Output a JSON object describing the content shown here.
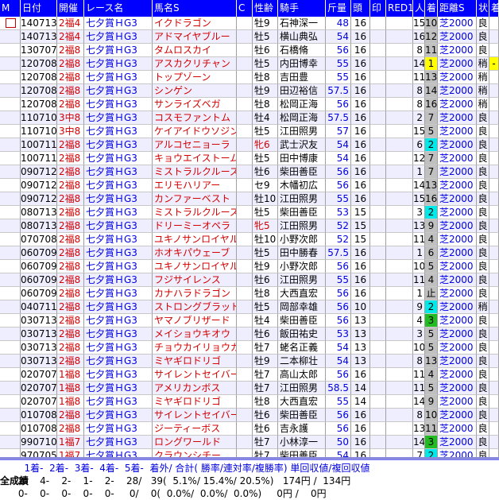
{
  "headers": [
    "M",
    "日付",
    "開催",
    "レース名",
    "馬名S",
    "C",
    "性齢",
    "騎手",
    "斤量",
    "頭",
    "印",
    "RED1",
    "人",
    "着",
    "距離S",
    "状",
    "着"
  ],
  "rows": [
    [
      "",
      "140713",
      "2福4",
      "七夕賞ＨG3",
      "イクドラゴン",
      "",
      "牡9",
      "石神深一",
      "48",
      "16",
      "",
      "",
      "15",
      "10",
      "芝2000",
      "良",
      ""
    ],
    [
      "",
      "140713",
      "2福4",
      "七夕賞ＨG3",
      "アドマイヤブルー",
      "",
      "牡5",
      "横山典弘",
      "54",
      "16",
      "",
      "",
      "16",
      "12",
      "芝2000",
      "良",
      ""
    ],
    [
      "",
      "130707",
      "2福8",
      "七夕賞ＨG3",
      "タムロスカイ",
      "",
      "牡6",
      "石橋脩",
      "56",
      "16",
      "",
      "",
      "8",
      "11",
      "芝2000",
      "良",
      ""
    ],
    [
      "",
      "120708",
      "2福8",
      "七夕賞ＨG3",
      "アスカクリチャン",
      "",
      "牡5",
      "内田博幸",
      "55",
      "16",
      "",
      "",
      "14",
      "1",
      "芝2000",
      "稍",
      "-"
    ],
    [
      "",
      "120708",
      "2福8",
      "七夕賞ＨG3",
      "トップゾーン",
      "",
      "牡8",
      "吉田豊",
      "55",
      "16",
      "",
      "",
      "11",
      "13",
      "芝2000",
      "稍",
      ""
    ],
    [
      "",
      "120708",
      "2福8",
      "七夕賞ＨG3",
      "シンゲン",
      "",
      "牡9",
      "田辺裕信",
      "57.5",
      "16",
      "",
      "",
      "8",
      "14",
      "芝2000",
      "稍",
      ""
    ],
    [
      "",
      "120708",
      "2福8",
      "七夕賞ＨG3",
      "サンライズベガ",
      "",
      "牡8",
      "松岡正海",
      "56",
      "16",
      "",
      "",
      "8",
      "16",
      "芝2000",
      "稍",
      ""
    ],
    [
      "",
      "110710",
      "3中8",
      "七夕賞ＨG3",
      "コスモファントム",
      "",
      "牡4",
      "松岡正海",
      "57.5",
      "16",
      "",
      "",
      "2",
      "7",
      "芝2000",
      "良",
      ""
    ],
    [
      "",
      "110710",
      "3中8",
      "七夕賞ＨG3",
      "ケイアイドウソジン",
      "",
      "牡5",
      "江田照男",
      "57",
      "16",
      "",
      "",
      "15",
      "5",
      "芝2000",
      "良",
      ""
    ],
    [
      "",
      "100711",
      "2福8",
      "七夕賞ＨG3",
      "アルコセニョーラ",
      "",
      "牝6",
      "武士沢友",
      "54",
      "16",
      "",
      "",
      "6",
      "2",
      "芝2000",
      "良",
      ""
    ],
    [
      "",
      "100711",
      "2福8",
      "七夕賞ＨG3",
      "キョウエイストーム",
      "",
      "牡5",
      "田中博康",
      "54",
      "16",
      "",
      "",
      "12",
      "7",
      "芝2000",
      "良",
      ""
    ],
    [
      "",
      "090712",
      "2福8",
      "七夕賞ＨG3",
      "ミストラルクルーズ",
      "",
      "牡6",
      "柴田善臣",
      "56",
      "16",
      "",
      "",
      "1",
      "7",
      "芝2000",
      "良",
      ""
    ],
    [
      "",
      "090712",
      "2福8",
      "七夕賞ＨG3",
      "エリモハリアー",
      "",
      "セ9",
      "木幡初広",
      "56",
      "16",
      "",
      "",
      "14",
      "13",
      "芝2000",
      "良",
      ""
    ],
    [
      "",
      "090712",
      "2福8",
      "七夕賞ＨG3",
      "カンファーベスト",
      "",
      "牡10",
      "江田照男",
      "55",
      "16",
      "",
      "",
      "15",
      "16",
      "芝2000",
      "良",
      ""
    ],
    [
      "",
      "080713",
      "2福8",
      "七夕賞ＨG3",
      "ミストラルクルーズ",
      "",
      "牡5",
      "柴田善臣",
      "53",
      "15",
      "",
      "",
      "3",
      "2",
      "芝2000",
      "良",
      ""
    ],
    [
      "",
      "080713",
      "2福8",
      "七夕賞ＨG3",
      "ドリーミーオペラ",
      "",
      "牝5",
      "江田照男",
      "52",
      "15",
      "",
      "",
      "13",
      "9",
      "芝2000",
      "良",
      ""
    ],
    [
      "",
      "070708",
      "2福8",
      "七夕賞ＨG3",
      "ユキノサンロイヤル",
      "",
      "牡10",
      "小野次郎",
      "52",
      "15",
      "",
      "",
      "11",
      "4",
      "芝2000",
      "良",
      ""
    ],
    [
      "",
      "060709",
      "2福8",
      "七夕賞ＨG3",
      "ホオキパウェーブ",
      "",
      "牡5",
      "田中勝春",
      "57.5",
      "16",
      "",
      "",
      "1",
      "6",
      "芝2000",
      "良",
      ""
    ],
    [
      "",
      "060709",
      "2福8",
      "七夕賞ＨG3",
      "ユキノサンロイヤル",
      "",
      "牡9",
      "小野次郎",
      "56",
      "16",
      "",
      "",
      "10",
      "5",
      "芝2000",
      "良",
      ""
    ],
    [
      "",
      "060709",
      "2福8",
      "七夕賞ＨG3",
      "フジサイレンス",
      "",
      "牡6",
      "江田照男",
      "55",
      "16",
      "",
      "",
      "11",
      "4",
      "芝2000",
      "良",
      ""
    ],
    [
      "",
      "060709",
      "2福8",
      "七夕賞ＨG3",
      "カナハラドラゴン",
      "",
      "牡8",
      "大西直宏",
      "56",
      "16",
      "",
      "",
      "1",
      "止",
      "芝2000",
      "良",
      ""
    ],
    [
      "",
      "040711",
      "2福8",
      "七夕賞ＨG3",
      "ストロングブラッド",
      "",
      "牡5",
      "岡部幸雄",
      "56",
      "10",
      "",
      "",
      "9",
      "2",
      "芝2000",
      "稍",
      ""
    ],
    [
      "",
      "030713",
      "2福8",
      "七夕賞ＨG3",
      "ヤマノブリザード",
      "",
      "牡4",
      "柴田善臣",
      "56",
      "13",
      "",
      "",
      "4",
      "3",
      "芝2000",
      "良",
      ""
    ],
    [
      "",
      "030713",
      "2福8",
      "七夕賞ＨG3",
      "メイショウキオウ",
      "",
      "牡6",
      "飯田祐史",
      "53",
      "13",
      "",
      "",
      "3",
      "5",
      "芝2000",
      "良",
      ""
    ],
    [
      "",
      "030713",
      "2福8",
      "七夕賞ＨG3",
      "チョウカイリョウガ",
      "",
      "牡7",
      "蛯名正義",
      "54",
      "13",
      "",
      "",
      "10",
      "5",
      "芝2000",
      "良",
      ""
    ],
    [
      "",
      "030713",
      "2福8",
      "七夕賞ＨG3",
      "ミヤギロドリゴ",
      "",
      "牡9",
      "二本柳壮",
      "54",
      "13",
      "",
      "",
      "8",
      "13",
      "芝2000",
      "良",
      ""
    ],
    [
      "",
      "020707",
      "1福8",
      "七夕賞ＨG3",
      "サイレントセイバー",
      "",
      "牡7",
      "高山太郎",
      "56",
      "16",
      "",
      "",
      "11",
      "4",
      "芝2000",
      "良",
      ""
    ],
    [
      "",
      "020707",
      "1福8",
      "七夕賞ＨG3",
      "アメリカンボス",
      "",
      "牡7",
      "江田照男",
      "58.5",
      "14",
      "",
      "",
      "11",
      "5",
      "芝2000",
      "良",
      ""
    ],
    [
      "",
      "020707",
      "1福8",
      "七夕賞ＨG3",
      "ミヤギロドリゴ",
      "",
      "牡8",
      "大西直宏",
      "55",
      "14",
      "",
      "",
      "14",
      "9",
      "芝2000",
      "良",
      ""
    ],
    [
      "",
      "010708",
      "2福8",
      "七夕賞ＨG3",
      "サイレントセイバー",
      "",
      "牡6",
      "柴田善臣",
      "56",
      "16",
      "",
      "",
      "8",
      "10",
      "芝2000",
      "良",
      ""
    ],
    [
      "",
      "010708",
      "2福8",
      "七夕賞ＨG3",
      "ジーティーボス",
      "",
      "牡6",
      "吉永護",
      "56",
      "16",
      "",
      "",
      "13",
      "11",
      "芝2000",
      "良",
      ""
    ],
    [
      "",
      "990710",
      "1福7",
      "七夕賞ＨG3",
      "ロングワールド",
      "",
      "牡7",
      "小林淳一",
      "50",
      "16",
      "",
      "",
      "14",
      "3",
      "芝2000",
      "良",
      ""
    ],
    [
      "",
      "970705",
      "1福7",
      "七夕賞ＨG3",
      "クラウンシチー",
      "",
      "牡7",
      "柴田善臣",
      "54",
      "16",
      "",
      "",
      "7",
      "2",
      "芝2000",
      "良",
      ""
    ]
  ],
  "footer": {
    "line1": "        1着-  2着-  3着-  4着-  5着-  着外/ 合計( 勝率/連対率/複勝率) 単回収値/複回収値",
    "label": "全成績",
    "line2": "      2-    4-    2-    1-    2-    28/   39(  5.1%/ 15.4%/ 20.5%)   174円 /  134円",
    "line3": "      0-    0-    0-    0-    0-     0/    0(  0.0%/  0.0%/  0.0%)     0円 /    0円"
  },
  "colors": {
    "header_bg": "#0000ff",
    "rank_bg": "#c0c0c0",
    "win_bg": "#ffff00",
    "second_bg": "#00e8e8",
    "third_bg": "#22bb22",
    "odd_row_bg": "#eeeeff",
    "even_row_bg": "#ffffff"
  }
}
